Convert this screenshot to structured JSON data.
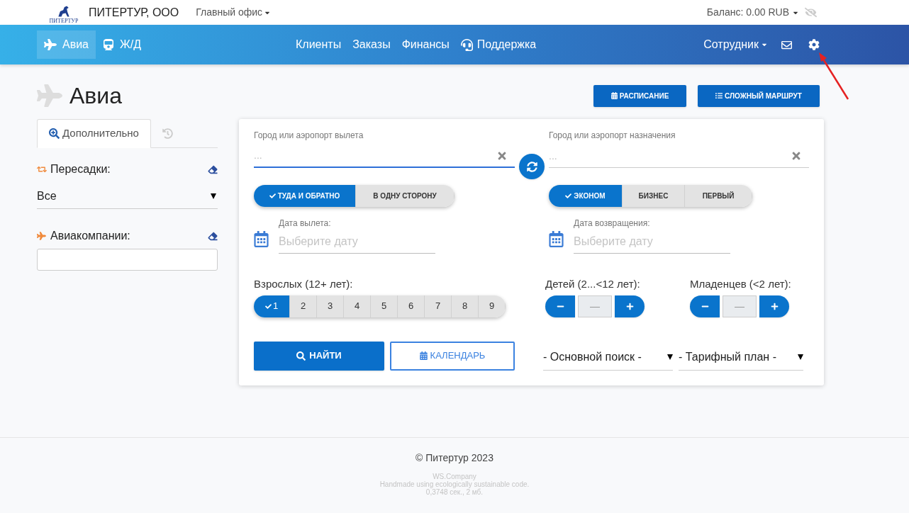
{
  "top_bar": {
    "logo_text": "ПИТЕРТУР",
    "company": "ПИТЕРТУР, ООО",
    "office": "Главный офис",
    "balance": "Баланс: 0.00 RUB"
  },
  "nav": {
    "left": [
      {
        "kind": "plane",
        "label": "Авиа",
        "selected": true
      },
      {
        "kind": "train",
        "label": "Ж/Д",
        "selected": false
      }
    ],
    "center": [
      {
        "kind": "text",
        "label": "Клиенты"
      },
      {
        "kind": "text",
        "label": "Заказы"
      },
      {
        "kind": "text",
        "label": "Финансы"
      },
      {
        "kind": "support",
        "label": "Поддержка"
      }
    ],
    "user": "Сотрудник"
  },
  "page": {
    "title": "Авиа",
    "buttons": [
      {
        "kind": "calendar",
        "label": "РАСПИСАНИЕ"
      },
      {
        "kind": "list",
        "label": "СЛОЖНЫЙ МАРШРУТ"
      }
    ]
  },
  "sidebar": {
    "tabs": [
      {
        "kind": "search",
        "label": "Дополнительно",
        "selected": true
      },
      {
        "kind": "history",
        "selected": false
      }
    ],
    "transfers": {
      "label": "Пересадки:",
      "value": "Все"
    },
    "airlines": {
      "label": "Авиакомпании:"
    }
  },
  "search": {
    "from": {
      "label": "Город или аэропорт вылета",
      "placeholder": "...",
      "focused": true
    },
    "to": {
      "label": "Город или аэропорт назначения",
      "placeholder": "...",
      "focused": false
    },
    "trip_type": [
      {
        "label": "ТУДА И ОБРАТНО",
        "selected": true
      },
      {
        "label": "В ОДНУ СТОРОНУ",
        "selected": false
      }
    ],
    "cabin": [
      {
        "label": "ЭКОНОМ",
        "selected": true
      },
      {
        "label": "БИЗНЕС",
        "selected": false
      },
      {
        "label": "ПЕРВЫЙ",
        "selected": false
      }
    ],
    "departure_date": {
      "label": "Дата вылета:",
      "placeholder": "Выберите дату"
    },
    "return_date": {
      "label": "Дата возвращения:",
      "placeholder": "Выберите дату"
    },
    "adults": {
      "label": "Взрослых (12+ лет):",
      "options": [
        {
          "label": "1",
          "selected": true
        },
        {
          "label": "2",
          "selected": false
        },
        {
          "label": "3",
          "selected": false
        },
        {
          "label": "4",
          "selected": false
        },
        {
          "label": "5",
          "selected": false
        },
        {
          "label": "6",
          "selected": false
        },
        {
          "label": "7",
          "selected": false
        },
        {
          "label": "8",
          "selected": false
        },
        {
          "label": "9",
          "selected": false
        }
      ]
    },
    "children": {
      "label": "Детей (2...<12 лет):",
      "placeholder": "—"
    },
    "infants": {
      "label": "Младенцев (<2 лет):",
      "placeholder": "—"
    },
    "find_button": "НАЙТИ",
    "calendar_button": "КАЛЕНДАРЬ",
    "search_mode": "- Основной поиск -",
    "fare_plan": "- Тарифный план -"
  },
  "footer": {
    "copyright": "© Питертур 2023",
    "credits": [
      "WS.Company",
      "Handmade using ecologically sustainable code.",
      "0,3748 сек., 2 мб."
    ]
  }
}
